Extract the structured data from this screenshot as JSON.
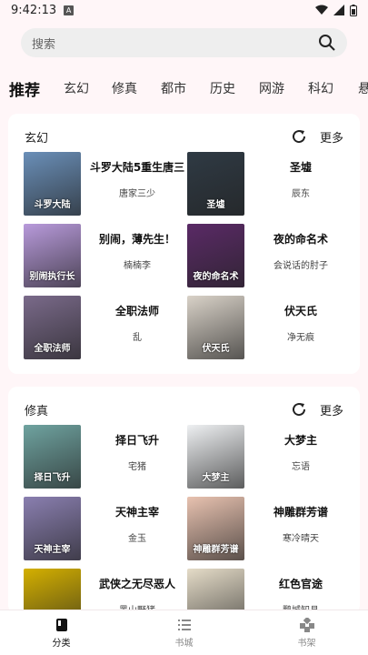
{
  "status": {
    "time": "9:42:13",
    "badge": "A"
  },
  "search": {
    "placeholder": "搜索"
  },
  "tabs": [
    {
      "label": "推荐",
      "active": true
    },
    {
      "label": "玄幻"
    },
    {
      "label": "修真"
    },
    {
      "label": "都市"
    },
    {
      "label": "历史"
    },
    {
      "label": "网游"
    },
    {
      "label": "科幻"
    },
    {
      "label": "悬"
    }
  ],
  "sections": [
    {
      "title": "玄幻",
      "more": "更多",
      "books": [
        {
          "title": "斗罗大陆5重生唐三",
          "author": "唐家三少",
          "cover_color": "#6a8fb8",
          "cover_text": "斗罗大陆"
        },
        {
          "title": "圣墟",
          "author": "辰东",
          "cover_color": "#2f3a44",
          "cover_text": "圣墟"
        },
        {
          "title": "别闹，薄先生！",
          "author": "楠楠李",
          "cover_color": "#b89adb",
          "cover_text": "别闹执行长"
        },
        {
          "title": "夜的命名术",
          "author": "会说话的肘子",
          "cover_color": "#5a2a66",
          "cover_text": "夜的命名术"
        },
        {
          "title": "全职法师",
          "author": "乱",
          "cover_color": "#7a6a8a",
          "cover_text": "全职法师"
        },
        {
          "title": "伏天氏",
          "author": "净无痕",
          "cover_color": "#d9d2c8",
          "cover_text": "伏天氏"
        }
      ]
    },
    {
      "title": "修真",
      "more": "更多",
      "books": [
        {
          "title": "择日飞升",
          "author": "宅猪",
          "cover_color": "#6fa3a0",
          "cover_text": "择日飞升"
        },
        {
          "title": "大梦主",
          "author": "忘语",
          "cover_color": "#eef0f2",
          "cover_text": "大梦主"
        },
        {
          "title": "天神主宰",
          "author": "金玉",
          "cover_color": "#8a7fb0",
          "cover_text": "天神主宰"
        },
        {
          "title": "神雕群芳谱",
          "author": "寒冷晴天",
          "cover_color": "#e8c2b0",
          "cover_text": "神雕群芳谱"
        },
        {
          "title": "武侠之无尽恶人",
          "author": "黑山野猪",
          "cover_color": "#d4b000",
          "cover_text": ""
        },
        {
          "title": "红色官途",
          "author": "鹏城知县",
          "cover_color": "#e5dcc8",
          "cover_text": ""
        }
      ]
    }
  ],
  "bottom_nav": [
    {
      "label": "分类",
      "icon": "book-icon",
      "active": true
    },
    {
      "label": "书城",
      "icon": "list-icon"
    },
    {
      "label": "书架",
      "icon": "grid-icon"
    }
  ],
  "colors": {
    "background": "#fff6f8",
    "card": "#ffffff",
    "search_bg": "#eeeeee"
  }
}
